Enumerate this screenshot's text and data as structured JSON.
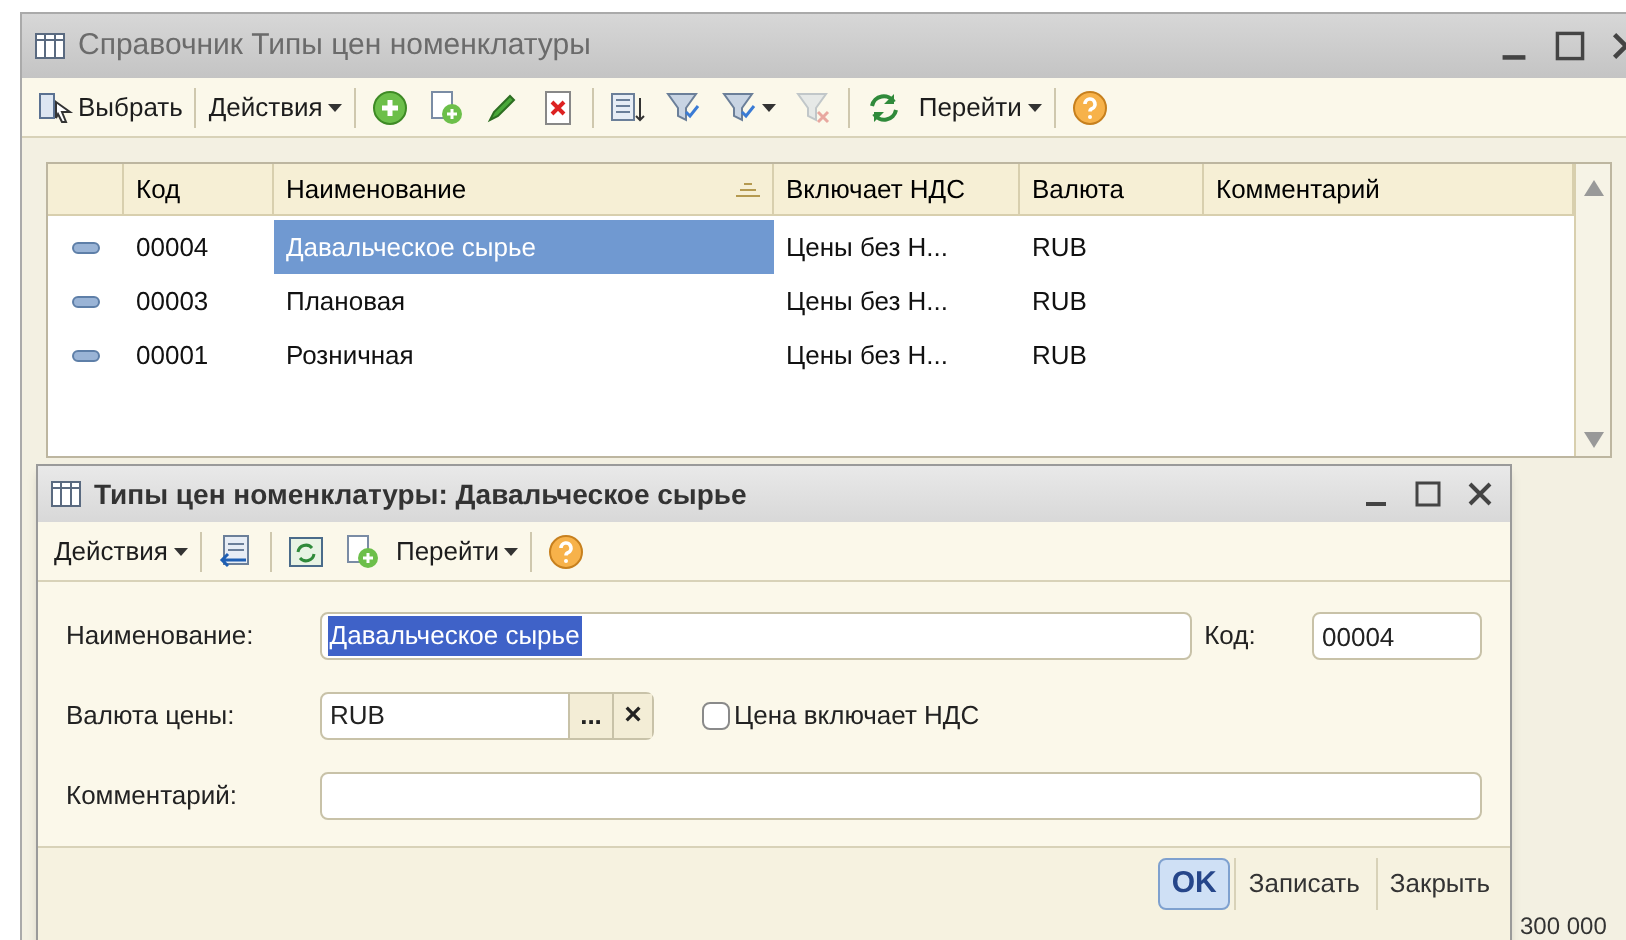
{
  "window": {
    "title": "Справочник Типы цен номенклатуры"
  },
  "toolbar": [
    {
      "kind": "icon-text",
      "label": "Выбрать"
    },
    {
      "kind": "sep"
    },
    {
      "kind": "menu",
      "label": "Действия"
    },
    {
      "kind": "sep"
    },
    {
      "kind": "icon"
    },
    {
      "kind": "icon"
    },
    {
      "kind": "icon"
    },
    {
      "kind": "icon"
    },
    {
      "kind": "sep"
    },
    {
      "kind": "icon"
    },
    {
      "kind": "icon"
    },
    {
      "kind": "icon"
    },
    {
      "kind": "icon",
      "disabled": true
    },
    {
      "kind": "sep"
    },
    {
      "kind": "icon"
    },
    {
      "kind": "menu",
      "label": "Перейти"
    },
    {
      "kind": "sep"
    },
    {
      "kind": "icon"
    }
  ],
  "table": {
    "columns": [
      "Код",
      "Наименование",
      "Включает НДС",
      "Валюта",
      "Комментарий"
    ],
    "rows": [
      {
        "code": "00004",
        "name": "Давальческое сырье",
        "vat": "Цены без Н...",
        "currency": "RUB",
        "selected": true
      },
      {
        "code": "00003",
        "name": "Плановая",
        "vat": "Цены без Н...",
        "currency": "RUB",
        "selected": false
      },
      {
        "code": "00001",
        "name": "Розничная",
        "vat": "Цены без Н...",
        "currency": "RUB",
        "selected": false
      }
    ]
  },
  "status_value": "300 000",
  "dialog": {
    "title": "Типы цен номенклатуры: Давальческое сырье",
    "toolbar": [
      {
        "kind": "menu",
        "label": "Действия"
      },
      {
        "kind": "sep"
      },
      {
        "kind": "icon"
      },
      {
        "kind": "sep"
      },
      {
        "kind": "icon"
      },
      {
        "kind": "icon"
      },
      {
        "kind": "menu",
        "label": "Перейти"
      },
      {
        "kind": "sep"
      },
      {
        "kind": "icon"
      }
    ],
    "name_label": "Наименование:",
    "name_value": "Давальческое сырье",
    "code_label": "Код:",
    "code_value": "00004",
    "currency_label": "Валюта цены:",
    "currency_value": "RUB",
    "select_btn": "...",
    "clear_btn": "×",
    "vat_checkbox": {
      "label": "Цена включает НДС",
      "checked": false
    },
    "comment_label": "Комментарий:",
    "buttons": [
      {
        "label": "OK",
        "default": true
      },
      {
        "label": "Записать",
        "default": false
      },
      {
        "label": "Закрыть",
        "default": false
      }
    ]
  }
}
